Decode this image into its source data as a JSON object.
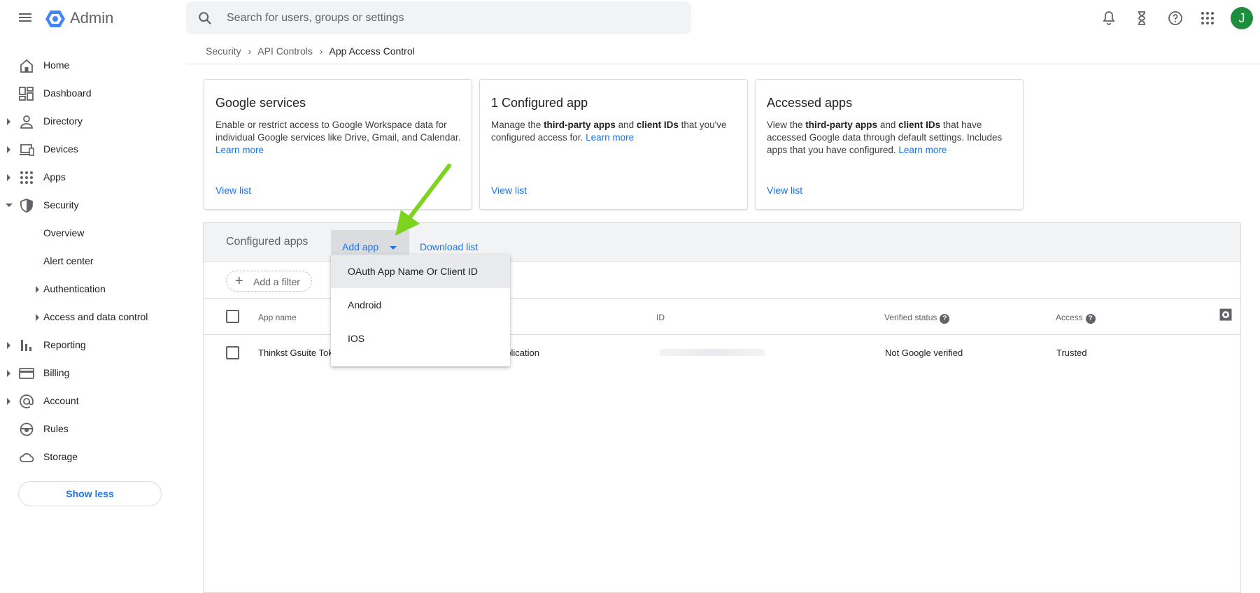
{
  "app": {
    "title": "Admin"
  },
  "search": {
    "placeholder": "Search for users, groups or settings"
  },
  "user": {
    "avatar_initial": "J"
  },
  "sidebar": {
    "items": [
      {
        "label": "Home",
        "icon": "home-icon"
      },
      {
        "label": "Dashboard",
        "icon": "dashboard-icon"
      },
      {
        "label": "Directory",
        "icon": "person-icon"
      },
      {
        "label": "Devices",
        "icon": "devices-icon"
      },
      {
        "label": "Apps",
        "icon": "apps-grid-icon"
      },
      {
        "label": "Security",
        "icon": "shield-icon"
      },
      {
        "label": "Overview"
      },
      {
        "label": "Alert center"
      },
      {
        "label": "Authentication"
      },
      {
        "label": "Access and data control"
      },
      {
        "label": "Reporting",
        "icon": "bar-chart-icon"
      },
      {
        "label": "Billing",
        "icon": "credit-card-icon"
      },
      {
        "label": "Account",
        "icon": "at-sign-icon"
      },
      {
        "label": "Rules",
        "icon": "steering-icon"
      },
      {
        "label": "Storage",
        "icon": "cloud-icon"
      }
    ],
    "show_less": "Show less"
  },
  "breadcrumb": {
    "items": [
      "Security",
      "API Controls",
      "App Access Control"
    ]
  },
  "cards": [
    {
      "title": "Google services",
      "desc_plain": "Enable or restrict access to Google Workspace data for individual Google services like Drive, Gmail, and Calendar.",
      "learn_more": "Learn more",
      "view_list": "View list"
    },
    {
      "title": "1 Configured app",
      "desc_pre": "Manage the ",
      "desc_bold1": "third-party apps",
      "desc_mid": " and ",
      "desc_bold2": "client IDs",
      "desc_post": " that you've configured access for.",
      "learn_more": "Learn more",
      "view_list": "View list"
    },
    {
      "title": "Accessed apps",
      "desc_pre": "View the ",
      "desc_bold1": "third-party apps",
      "desc_mid": " and ",
      "desc_bold2": "client IDs",
      "desc_post": " that have accessed Google data through default settings. Includes apps that you have configured.",
      "learn_more": "Learn more",
      "view_list": "View list"
    }
  ],
  "panel": {
    "title": "Configured apps",
    "add_app": "Add app",
    "download": "Download list",
    "add_filter": "Add a filter",
    "columns": {
      "app_name": "App name",
      "id": "ID",
      "verified_status": "Verified status",
      "access": "Access"
    },
    "rows": [
      {
        "app_name": "Thinkst Gsuite Tok",
        "type": "pplication",
        "verified": "Not Google verified",
        "access": "Trusted"
      }
    ]
  },
  "dropdown": {
    "options": [
      "OAuth App Name Or Client ID",
      "Android",
      "IOS"
    ]
  },
  "colors": {
    "accent": "#1a73e8",
    "arrow": "#7ed321",
    "avatar": "#1e8e3e"
  }
}
